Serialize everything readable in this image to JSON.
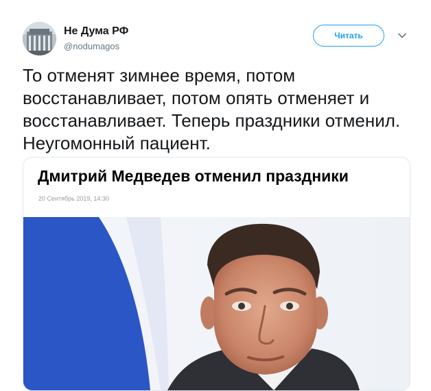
{
  "tweet": {
    "author_name": "Не Дума РФ",
    "author_handle": "@nodumagos",
    "follow_label": "Читать",
    "text": "То отменят зимнее время, потом восстанавливает, потом опять отменяет и восстанавливает. Теперь праздники отменил. Неугомонный пациент."
  },
  "card": {
    "headline": "Дмитрий Медведев отменил праздники",
    "date": "20 Сентябрь 2019, 14:30"
  },
  "icons": {
    "menu": "chevron-down-icon",
    "avatar": "building-photo"
  },
  "colors": {
    "accent": "#1da1f2",
    "text": "#14171a",
    "secondary": "#657786"
  }
}
